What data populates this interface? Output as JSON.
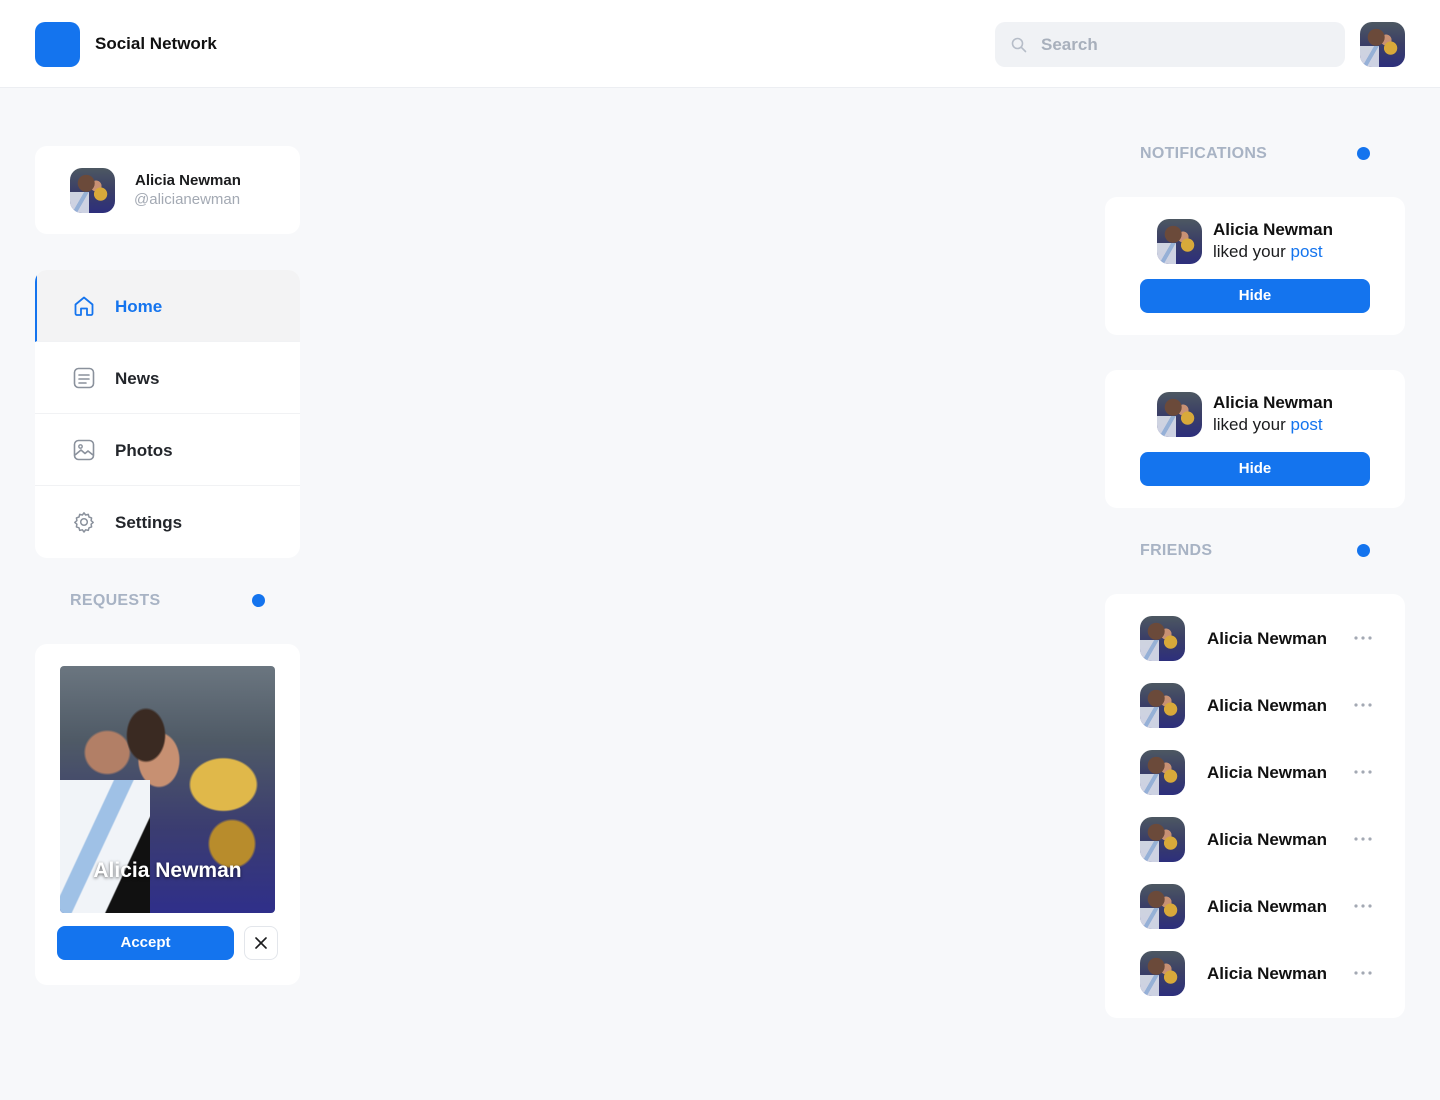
{
  "header": {
    "app_title": "Social Network",
    "search_placeholder": "Search",
    "accent_color": "#1474ee"
  },
  "profile": {
    "name": "Alicia Newman",
    "handle": "@alicianewman"
  },
  "nav": {
    "items": [
      {
        "label": "Home",
        "icon": "home-icon",
        "active": true
      },
      {
        "label": "News",
        "icon": "news-icon",
        "active": false
      },
      {
        "label": "Photos",
        "icon": "photos-icon",
        "active": false
      },
      {
        "label": "Settings",
        "icon": "gear-icon",
        "active": false
      }
    ]
  },
  "requests": {
    "title": "REQUESTS",
    "name": "Alicia Newman",
    "accept_label": "Accept"
  },
  "notifications": {
    "title": "NOTIFICATIONS",
    "items": [
      {
        "name": "Alicia Newman",
        "text": "liked your",
        "link": "post",
        "button": "Hide"
      },
      {
        "name": "Alicia Newman",
        "text": "liked your",
        "link": "post",
        "button": "Hide"
      }
    ]
  },
  "friends": {
    "title": "FRIENDS",
    "items": [
      {
        "name": "Alicia Newman"
      },
      {
        "name": "Alicia Newman"
      },
      {
        "name": "Alicia Newman"
      },
      {
        "name": "Alicia Newman"
      },
      {
        "name": "Alicia Newman"
      },
      {
        "name": "Alicia Newman"
      }
    ]
  }
}
